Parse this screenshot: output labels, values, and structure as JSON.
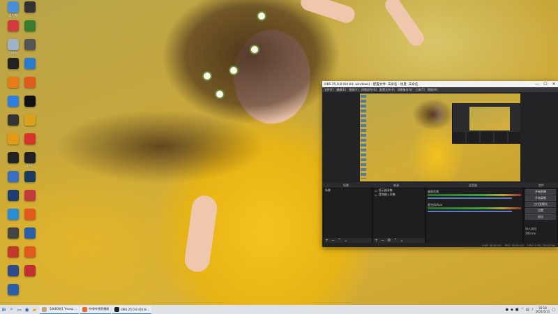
{
  "colors": {
    "obs_bg": "#2b2b2e",
    "taskbar_bg": "#dfe3e8",
    "accent": "#2f7fd7",
    "wallpaper_yellow": "#e7b415"
  },
  "desktop_icons": [
    {
      "label": "此电脑",
      "icon": "computer-icon",
      "color": "#4a8fd6"
    },
    {
      "label": "",
      "icon": "app-icon",
      "color": "#d23b3b"
    },
    {
      "label": "回收站",
      "icon": "recycle-bin-icon",
      "color": "#9fb3c8"
    },
    {
      "label": "",
      "icon": "app-icon",
      "color": "#222"
    },
    {
      "label": "",
      "icon": "app-icon",
      "color": "#e67c16"
    },
    {
      "label": "",
      "icon": "app-icon",
      "color": "#2d7fe0"
    },
    {
      "label": "",
      "icon": "app-icon",
      "color": "#333"
    },
    {
      "label": "",
      "icon": "app-icon",
      "color": "#e29a18"
    },
    {
      "label": "",
      "icon": "app-icon",
      "color": "#222"
    },
    {
      "label": "",
      "icon": "app-icon",
      "color": "#3a6ec0"
    },
    {
      "label": "",
      "icon": "app-icon",
      "color": "#1e3f6d"
    },
    {
      "label": "",
      "icon": "app-icon",
      "color": "#2a8cd6"
    },
    {
      "label": "",
      "icon": "app-icon",
      "color": "#444"
    },
    {
      "label": "",
      "icon": "app-icon",
      "color": "#c23a2a"
    },
    {
      "label": "",
      "icon": "app-icon",
      "color": "#2d4a8a"
    },
    {
      "label": "",
      "icon": "app-icon",
      "color": "#2b5ea8"
    },
    {
      "label": "",
      "icon": "app-icon",
      "color": "#333"
    },
    {
      "label": "",
      "icon": "app-icon",
      "color": "#3b7d2f"
    },
    {
      "label": "",
      "icon": "app-icon",
      "color": "#555"
    },
    {
      "label": "",
      "icon": "app-icon",
      "color": "#2a7bd0"
    },
    {
      "label": "",
      "icon": "app-icon",
      "color": "#e05a1e"
    },
    {
      "label": "",
      "icon": "app-icon",
      "color": "#111"
    },
    {
      "label": "",
      "icon": "app-icon",
      "color": "#d9a21c"
    },
    {
      "label": "",
      "icon": "app-icon",
      "color": "#d6342c"
    },
    {
      "label": "EPIC",
      "icon": "epic-games-icon",
      "color": "#222"
    },
    {
      "label": "",
      "icon": "steam-icon",
      "color": "#1b3a5e"
    },
    {
      "label": "",
      "icon": "app-icon",
      "color": "#c43b3b"
    },
    {
      "label": "",
      "icon": "app-icon",
      "color": "#e05a1e"
    },
    {
      "label": "",
      "icon": "app-icon",
      "color": "#2b5ea8"
    },
    {
      "label": "",
      "icon": "app-icon",
      "color": "#e05a1e"
    },
    {
      "label": "",
      "icon": "app-icon",
      "color": "#c03030"
    }
  ],
  "obs": {
    "title": "OBS 25.0.8 (64 bit, windows) - 配置文件: 未命名 - 场景: 未命名",
    "minimize": "—",
    "maximize": "☐",
    "close": "✕",
    "menu": [
      "文件(F)",
      "编辑(E)",
      "视图(V)",
      "停靠部件(D)",
      "配置文件(P)",
      "场景集合(S)",
      "工具(T)",
      "帮助(H)"
    ],
    "docks": {
      "scenes_title": "场景",
      "sources_title": "来源",
      "mixer_title": "混音器",
      "transitions_title": "转场",
      "controls_title": "控件"
    },
    "scenes": [
      "场景"
    ],
    "sources": [
      "显示器采集",
      "音频输入采集"
    ],
    "mixer": [
      {
        "name": "桌面音频"
      },
      {
        "name": "麦克风/Aux"
      }
    ],
    "controls": [
      "开始直播",
      "开始录制",
      "工作室模式",
      "设置",
      "退出"
    ],
    "transition": {
      "label": "淡入淡出",
      "duration": "300 ms"
    },
    "status": [
      "LIVE: 00:00:00",
      "REC: 00:00:00",
      "CPU: 2.9%, 30.00 fps"
    ]
  },
  "taskbar": {
    "apps": [
      {
        "label": "【4K60帧】Young ...",
        "color": "#c8a27a"
      },
      {
        "label": "哔哩哔哩直播姬",
        "color": "#e86a2a"
      },
      {
        "label": "OBS 25.0.8 (64 bi...",
        "color": "#222"
      }
    ],
    "time": "16:18",
    "date": "2021/5/11"
  }
}
